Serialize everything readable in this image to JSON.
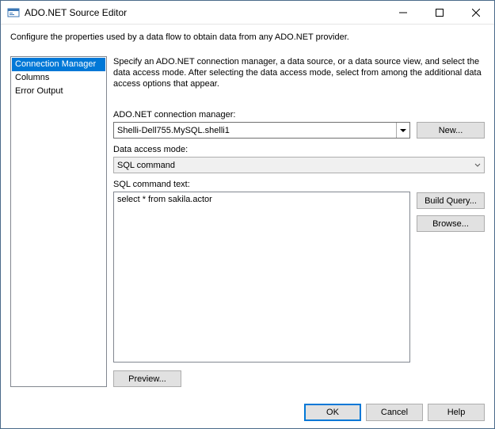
{
  "window": {
    "title": "ADO.NET Source Editor"
  },
  "instructions": "Configure the properties used by a data flow to obtain data from any ADO.NET provider.",
  "nav": {
    "items": [
      {
        "label": "Connection Manager",
        "selected": true
      },
      {
        "label": "Columns",
        "selected": false
      },
      {
        "label": "Error Output",
        "selected": false
      }
    ]
  },
  "pane": {
    "description": "Specify an ADO.NET connection manager, a data source, or a data source view, and select the data access mode. After selecting the data access mode, select from among the additional data access options that appear.",
    "conn_label": "ADO.NET connection manager:",
    "conn_value": "Shelli-Dell755.MySQL.shelli1",
    "new_label": "New...",
    "mode_label": "Data access mode:",
    "mode_value": "SQL command",
    "sql_label": "SQL command text:",
    "sql_value": "select * from sakila.actor",
    "build_query_label": "Build Query...",
    "browse_label": "Browse...",
    "preview_label": "Preview..."
  },
  "footer": {
    "ok": "OK",
    "cancel": "Cancel",
    "help": "Help"
  }
}
